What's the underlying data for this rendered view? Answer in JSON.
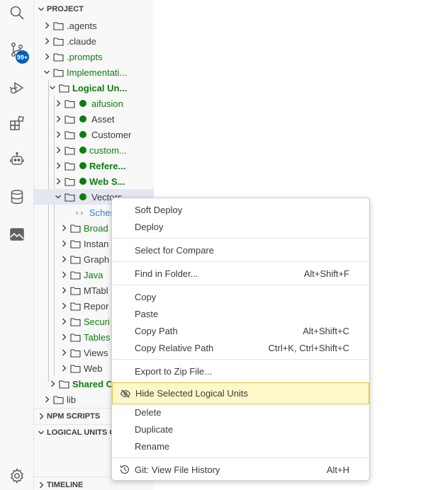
{
  "activity_bar": {
    "scm_badge": "99+",
    "icons": [
      "search-icon",
      "source-control-icon",
      "run-debug-icon",
      "extensions-icon",
      "copilot-icon",
      "database-icon",
      "image-preview-icon",
      "settings-gear-icon"
    ]
  },
  "explorer": {
    "project_header": "PROJECT",
    "tree": [
      {
        "label": ".agents"
      },
      {
        "label": ".claude"
      },
      {
        "label": ".prompts"
      },
      {
        "label": "Implementati..."
      },
      {
        "label": "Logical Un..."
      },
      {
        "label": "aifusion"
      },
      {
        "label": "Asset"
      },
      {
        "label": "Customer"
      },
      {
        "label": "custom..."
      },
      {
        "label": "Refere..."
      },
      {
        "label": "Web S..."
      },
      {
        "label": "Vectors"
      },
      {
        "label": "Schem"
      },
      {
        "label": "Broad"
      },
      {
        "label": "Instan"
      },
      {
        "label": "Graph"
      },
      {
        "label": "Java"
      },
      {
        "label": "MTabl"
      },
      {
        "label": "Repor"
      },
      {
        "label": "Securi"
      },
      {
        "label": "Tables"
      },
      {
        "label": "Views"
      },
      {
        "label": "Web"
      },
      {
        "label": "Shared C"
      },
      {
        "label": "lib"
      }
    ],
    "npm_scripts_header": "NPM SCRIPTS",
    "logical_units_header": "LOGICAL UNITS G",
    "timeline_header": "TIMELINE"
  },
  "context_menu": {
    "soft_deploy": "Soft Deploy",
    "deploy": "Deploy",
    "select_compare": "Select for Compare",
    "find_in_folder": "Find in Folder...",
    "find_in_folder_kb": "Alt+Shift+F",
    "copy": "Copy",
    "paste": "Paste",
    "copy_path": "Copy Path",
    "copy_path_kb": "Alt+Shift+C",
    "copy_relative_path": "Copy Relative Path",
    "copy_relative_path_kb": "Ctrl+K, Ctrl+Shift+C",
    "export_zip": "Export to Zip File...",
    "hide_logical_units": "Hide Selected Logical Units",
    "delete": "Delete",
    "duplicate": "Duplicate",
    "rename": "Rename",
    "git_history": "Git: View File History",
    "git_history_kb": "Alt+H"
  }
}
